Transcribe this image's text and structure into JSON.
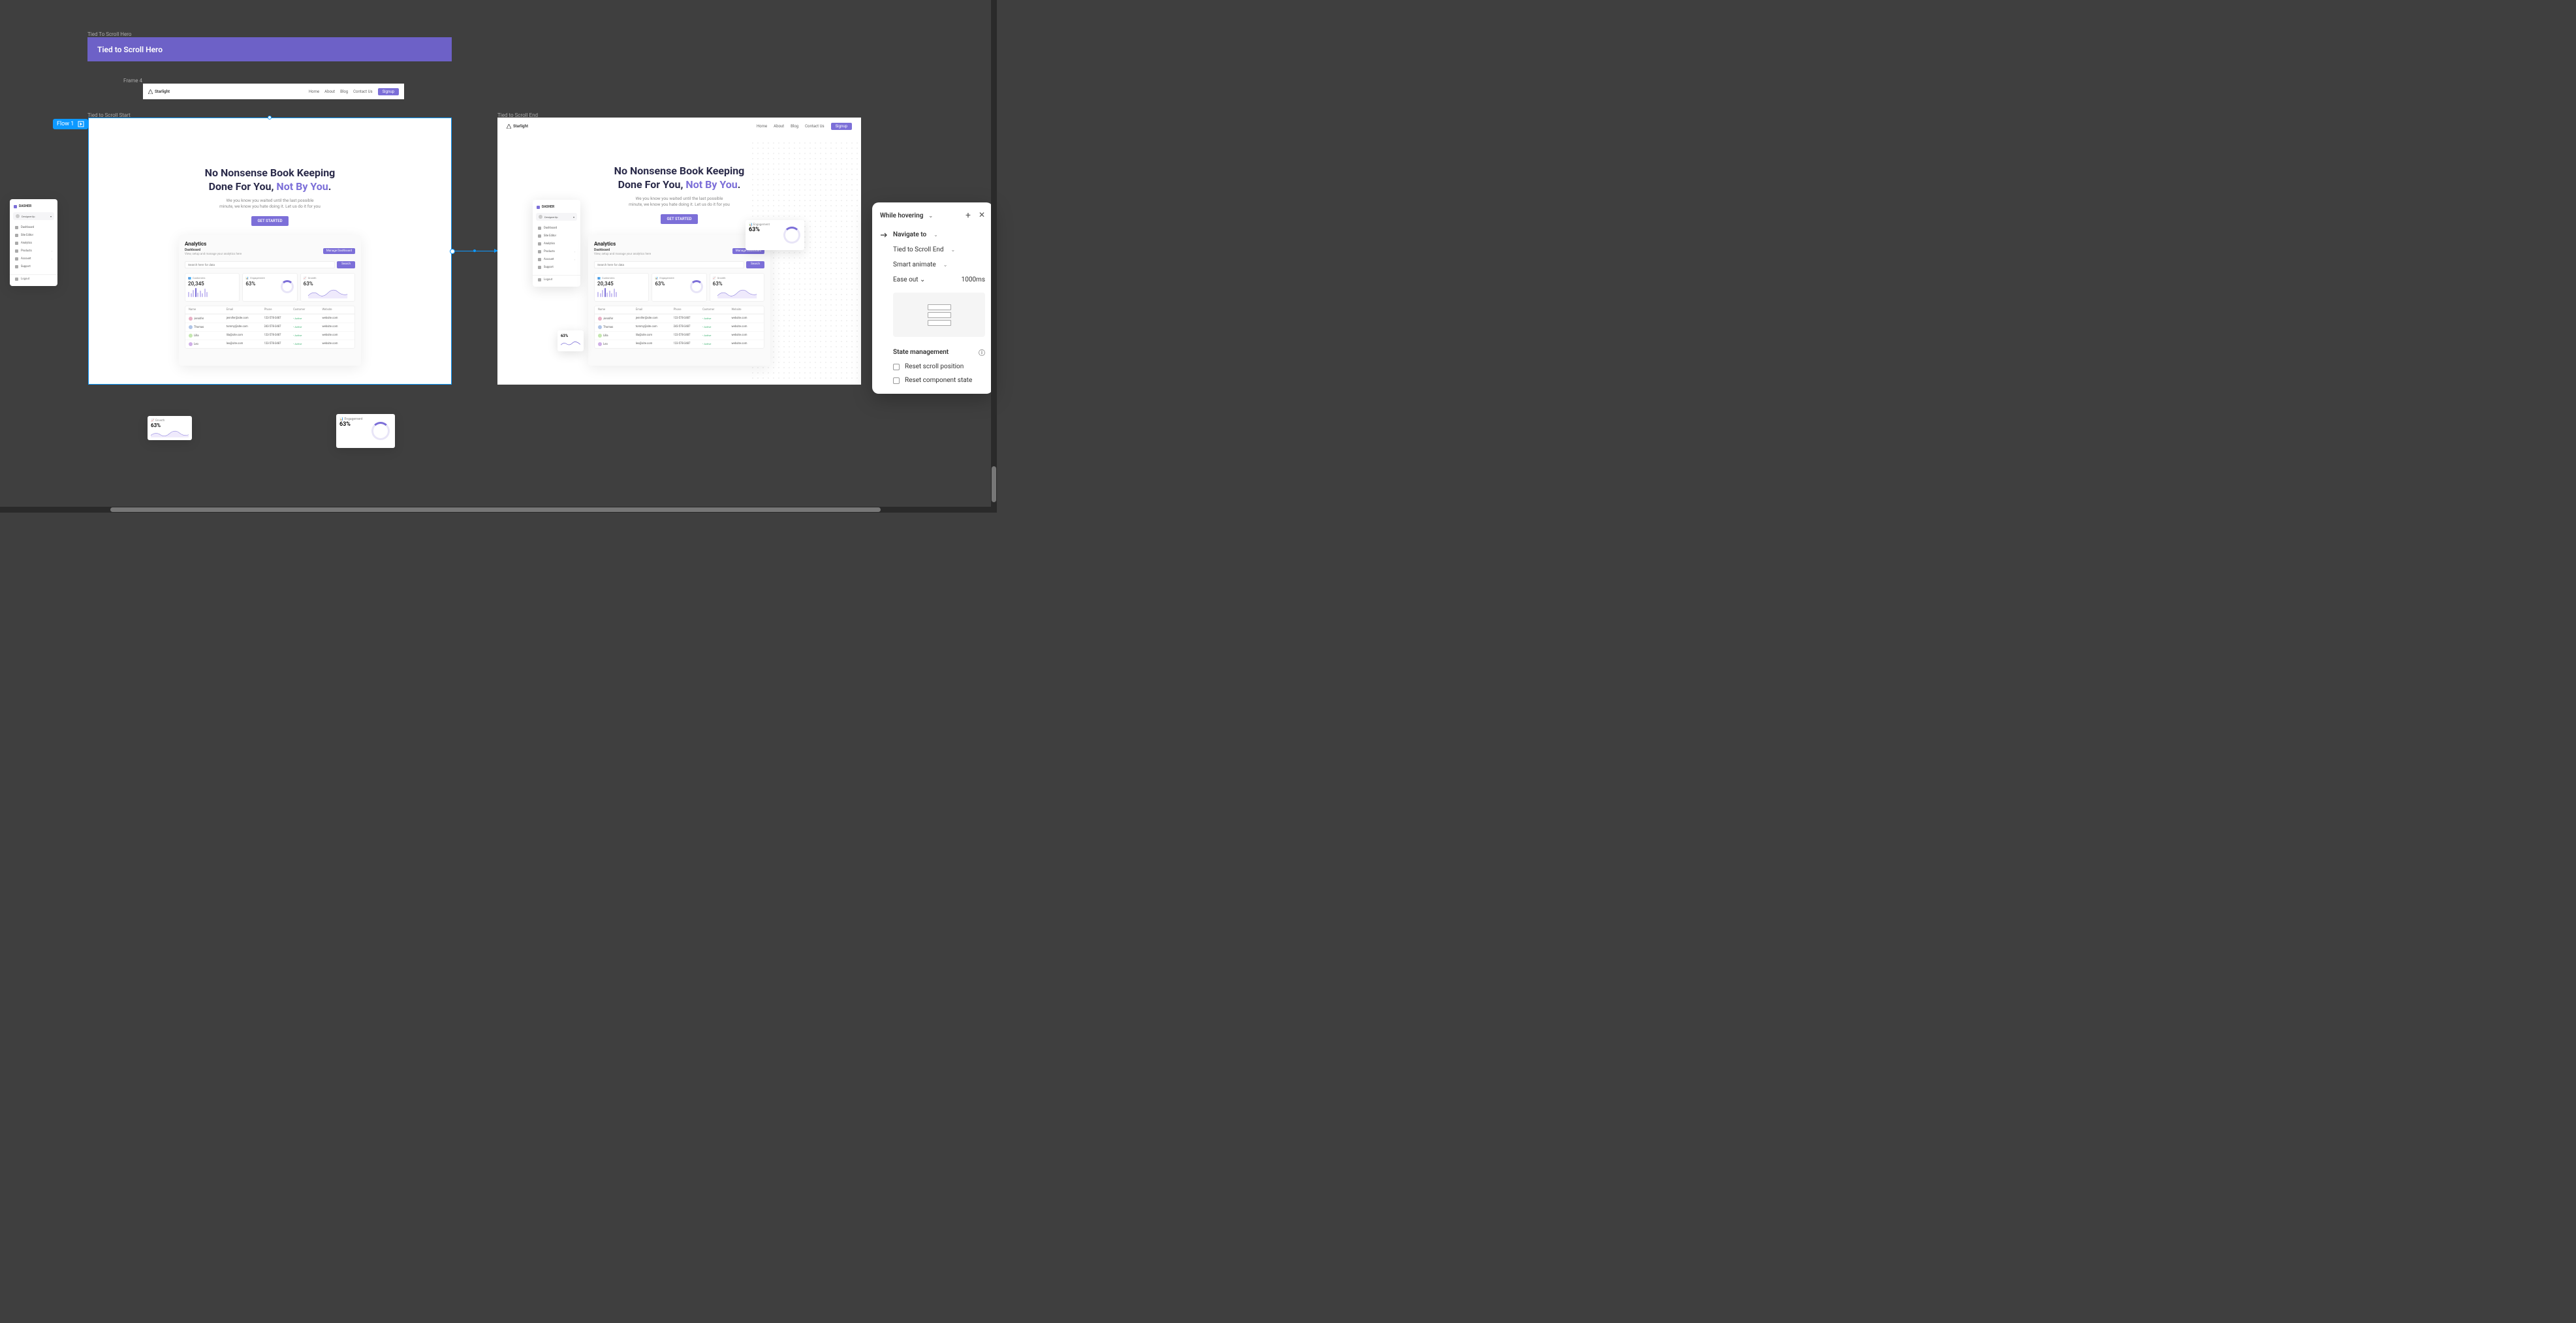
{
  "canvas": {
    "label_top": "Tied To Scroll Hero",
    "banner_title": "Tied to Scroll Hero",
    "frame4_label": "Frame 4",
    "start_label": "Tied to Scroll Start",
    "end_label": "Tied to Scroll End",
    "flow_tag": "Flow 1"
  },
  "nav": {
    "brand": "Starlight",
    "links": [
      "Home",
      "About",
      "Blog",
      "Contact Us"
    ],
    "signup": "Signup"
  },
  "hero": {
    "title_line1": "No Nonsense Book Keeping",
    "title_line2a": "Done For You, ",
    "title_line2b": "Not By You",
    "title_line2c": ".",
    "subtitle_line1": "We you know you waited until the last possible",
    "subtitle_line2": "minute, we know you hate doing it. Let us do it for you",
    "cta": "GET STARTED"
  },
  "analytics": {
    "title": "Analytics",
    "subtitle": "Dashboard",
    "desc": "View, setup and manage your analytics here",
    "manage_btn": "Manage Dashboard",
    "search_placeholder": "Search here for data",
    "search_btn": "Search",
    "stats": {
      "customers": {
        "label": "Customers",
        "value": "20,345"
      },
      "engagement": {
        "label": "Engagement",
        "value": "63%"
      },
      "growth": {
        "label": "Growth",
        "value": "63%"
      }
    },
    "table": {
      "headers": [
        "Name",
        "Email",
        "Phone",
        "Customer",
        "Website"
      ],
      "rows": [
        {
          "name": "Jennifer",
          "email": "jennifer@site.com",
          "phone": "123-578-3487",
          "status": "• Active",
          "website": "website.com",
          "avatar": "#e8b0c5"
        },
        {
          "name": "Thomas",
          "email": "tommy@site.com",
          "phone": "243-578-3487",
          "status": "• Active",
          "website": "website.com",
          "avatar": "#b0c5e8"
        },
        {
          "name": "Lilla",
          "email": "lila@site.com",
          "phone": "123-578-3487",
          "status": "• Active",
          "website": "website.com",
          "avatar": "#c5e8b0"
        },
        {
          "name": "Leo",
          "email": "leo@site.com",
          "phone": "123-578-3487",
          "status": "• Active",
          "website": "website.com",
          "avatar": "#d0b0e8"
        }
      ]
    }
  },
  "dasher": {
    "title": "DASHER",
    "user": "DesignerUp",
    "menu": [
      {
        "label": "Dashboard",
        "chevron": false
      },
      {
        "label": "Site Editor",
        "chevron": false
      },
      {
        "label": "Analytics",
        "chevron": false
      },
      {
        "label": "Products",
        "chevron": true
      },
      {
        "label": "Account",
        "chevron": true
      },
      {
        "label": "Support",
        "chevron": false
      }
    ],
    "logout": "Logout"
  },
  "float_growth": {
    "label": "Growth",
    "value": "63%"
  },
  "float_engagement": {
    "label": "Engagement",
    "value": "63%"
  },
  "float_small": {
    "value": "63%"
  },
  "interactions": {
    "trigger": "While hovering",
    "action": "Navigate to",
    "destination": "Tied to Scroll End",
    "animation": "Smart animate",
    "easing": "Ease out",
    "duration": "1000ms",
    "state_header": "State management",
    "reset_scroll": "Reset scroll position",
    "reset_component": "Reset component state"
  }
}
